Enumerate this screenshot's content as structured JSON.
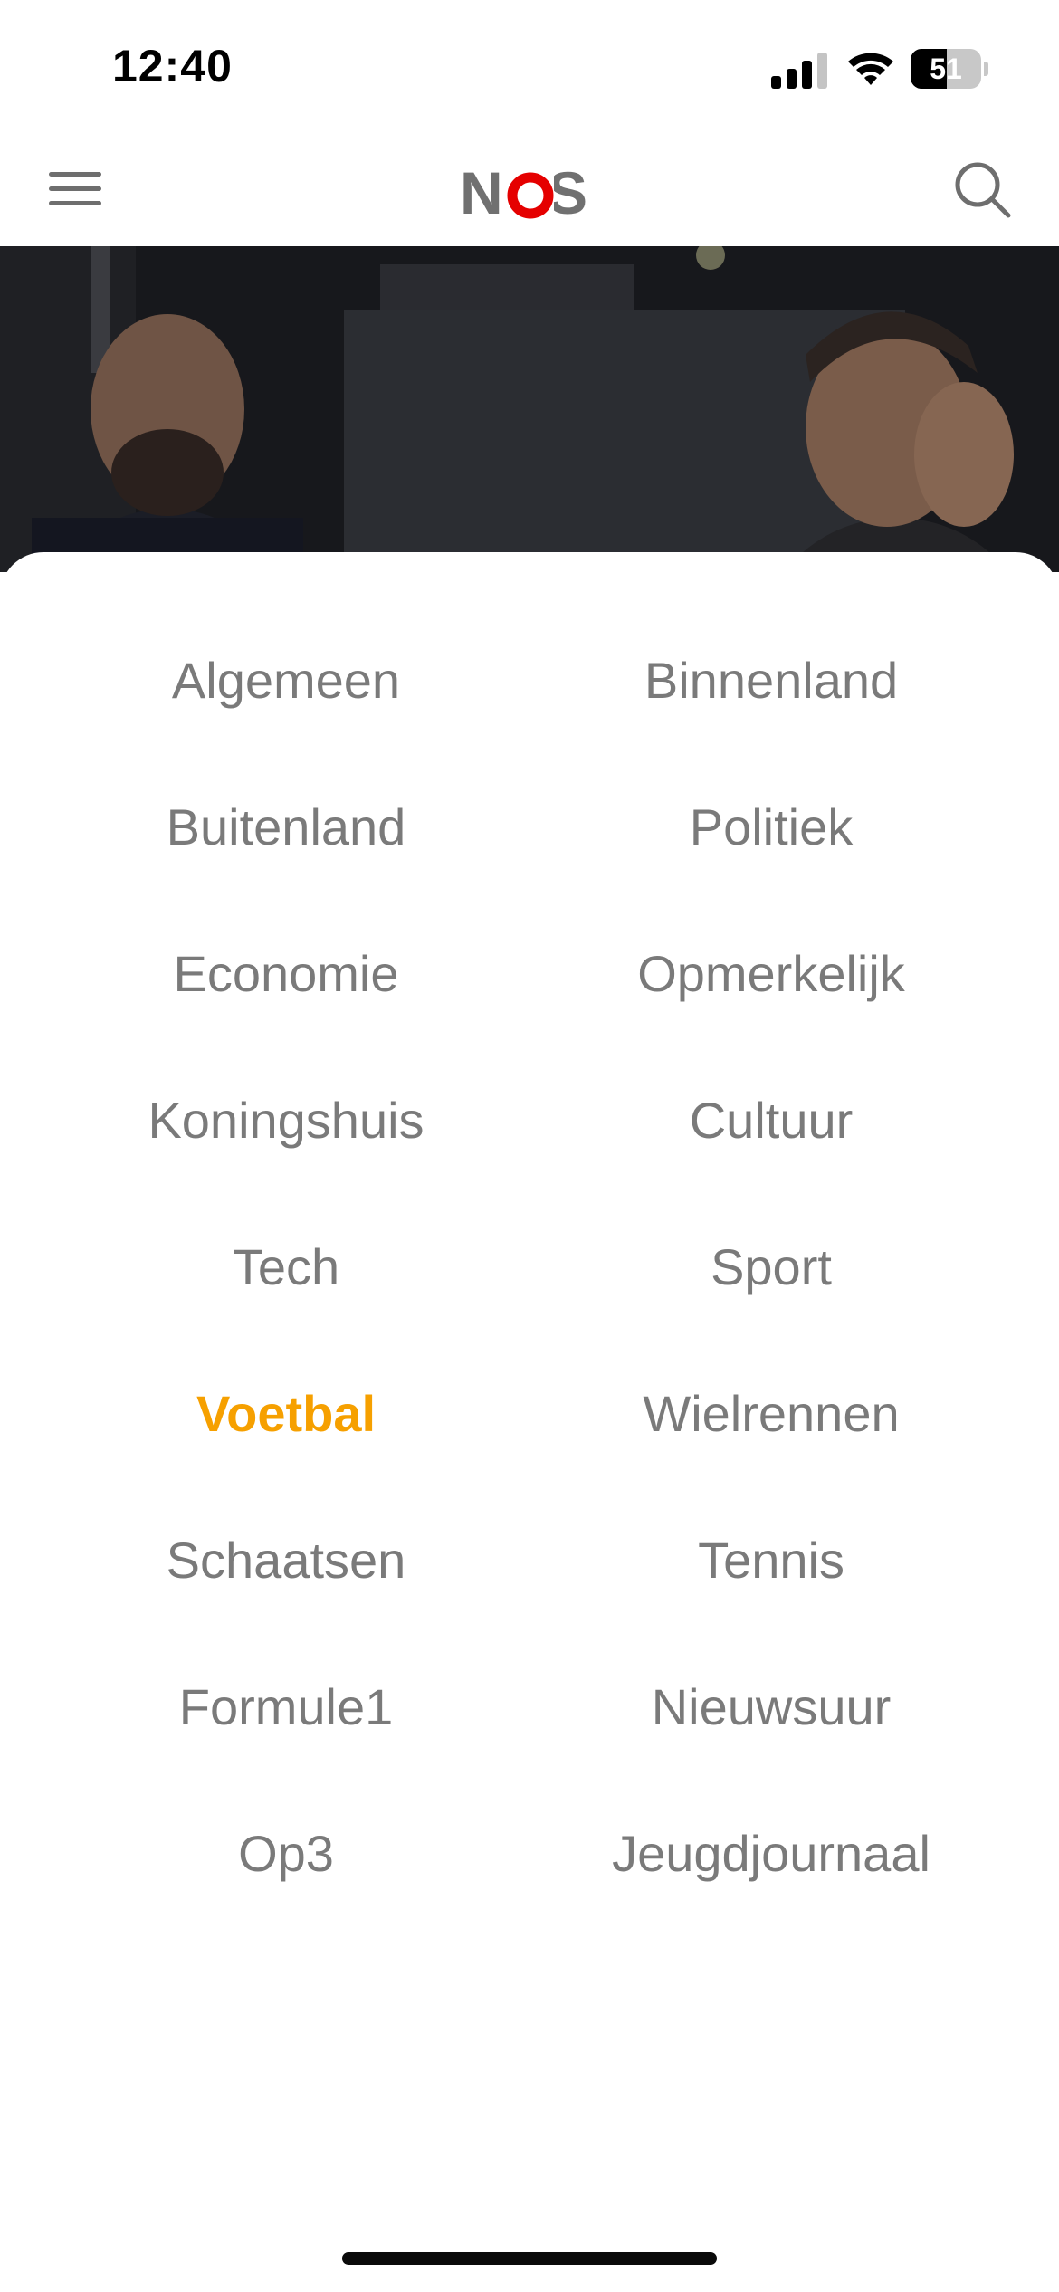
{
  "status_bar": {
    "time": "12:40",
    "battery_percent": "51",
    "battery_level": 0.51,
    "icons": [
      "signal-icon",
      "wifi-icon",
      "battery-icon"
    ]
  },
  "header": {
    "logo_text": "NOS",
    "logo_colors": {
      "letters": "#707070",
      "o": "#e50000"
    },
    "icons": [
      "menu-icon",
      "search-icon"
    ]
  },
  "categories": {
    "active": "Voetbal",
    "active_color": "#f6a000",
    "rows": [
      [
        "Algemeen",
        "Binnenland"
      ],
      [
        "Buitenland",
        "Politiek"
      ],
      [
        "Economie",
        "Opmerkelijk"
      ],
      [
        "Koningshuis",
        "Cultuur"
      ],
      [
        "Tech",
        "Sport"
      ],
      [
        "Voetbal",
        "Wielrennen"
      ],
      [
        "Schaatsen",
        "Tennis"
      ],
      [
        "Formule1",
        "Nieuwsuur"
      ],
      [
        "Op3",
        "Jeugdjournaal"
      ]
    ]
  }
}
